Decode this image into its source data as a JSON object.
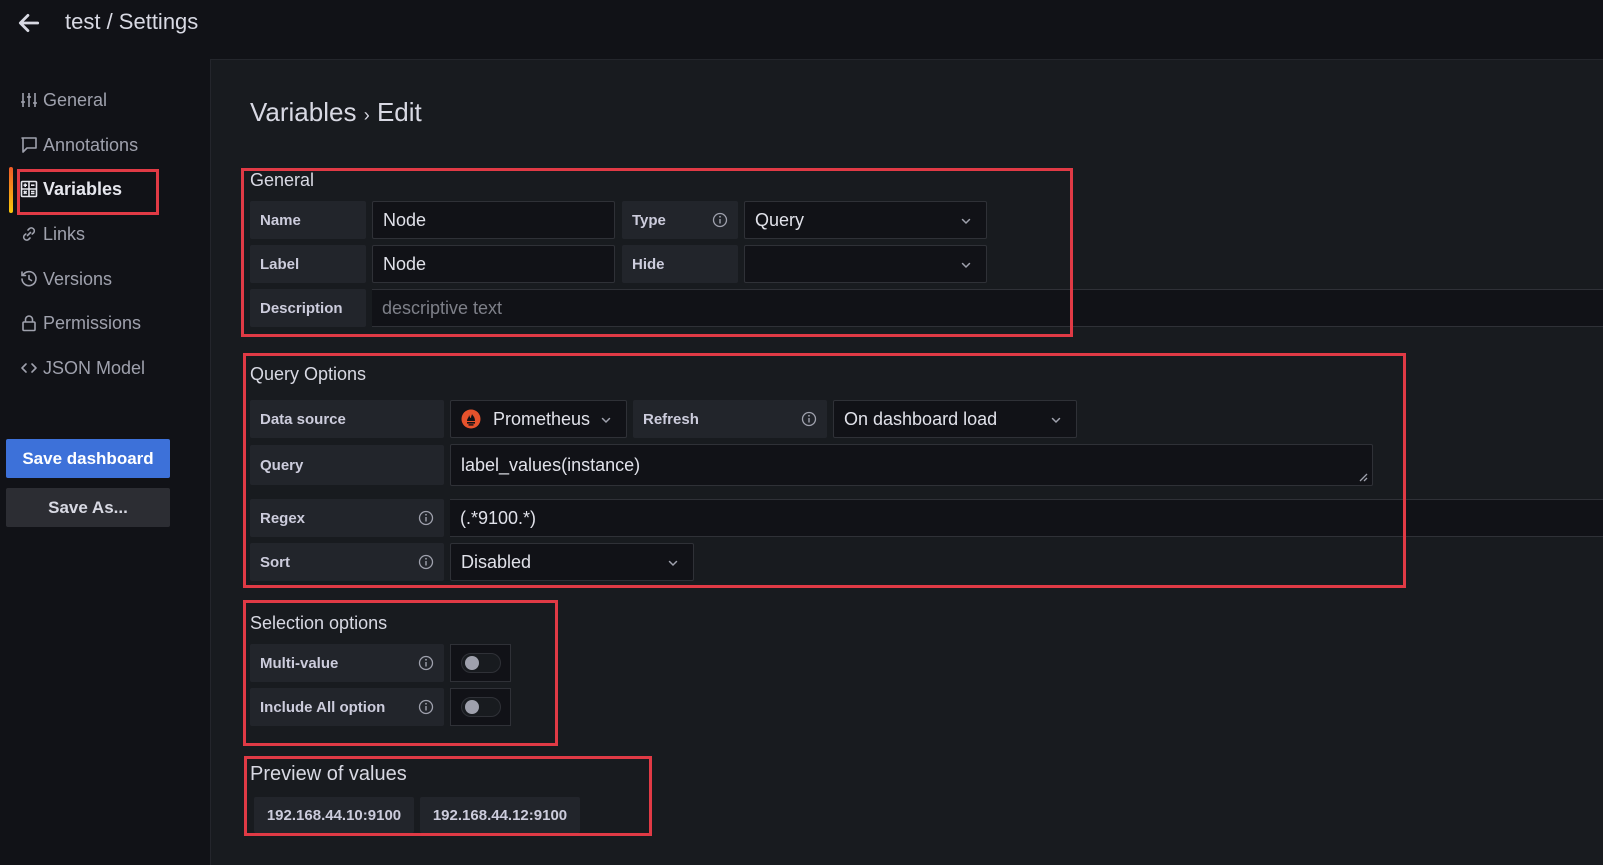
{
  "header": {
    "title": "test / Settings",
    "back_icon": "arrow-left-icon"
  },
  "sidebar": {
    "items": [
      {
        "label": "General",
        "icon": "sliders-icon",
        "active": false
      },
      {
        "label": "Annotations",
        "icon": "comment-icon",
        "active": false
      },
      {
        "label": "Variables",
        "icon": "calculator-icon",
        "active": true
      },
      {
        "label": "Links",
        "icon": "link-icon",
        "active": false
      },
      {
        "label": "Versions",
        "icon": "history-icon",
        "active": false
      },
      {
        "label": "Permissions",
        "icon": "lock-icon",
        "active": false
      },
      {
        "label": "JSON Model",
        "icon": "code-icon",
        "active": false
      }
    ],
    "save_label": "Save dashboard",
    "save_as_label": "Save As..."
  },
  "main": {
    "breadcrumb": {
      "parent": "Variables",
      "separator": "›",
      "current": "Edit"
    },
    "general": {
      "title": "General",
      "name_label": "Name",
      "name_value": "Node",
      "type_label": "Type",
      "type_value": "Query",
      "label_label": "Label",
      "label_value": "Node",
      "hide_label": "Hide",
      "hide_value": "",
      "description_label": "Description",
      "description_placeholder": "descriptive text"
    },
    "query_options": {
      "title": "Query Options",
      "datasource_label": "Data source",
      "datasource_value": "Prometheus",
      "datasource_icon": "prometheus-icon",
      "datasource_color": "#e6522c",
      "refresh_label": "Refresh",
      "refresh_value": "On dashboard load",
      "query_label": "Query",
      "query_value": "label_values(instance)",
      "regex_label": "Regex",
      "regex_value": "(.*9100.*)",
      "sort_label": "Sort",
      "sort_value": "Disabled"
    },
    "selection_options": {
      "title": "Selection options",
      "multi_value_label": "Multi-value",
      "multi_value_enabled": false,
      "include_all_label": "Include All option",
      "include_all_enabled": false
    },
    "preview": {
      "title": "Preview of values",
      "values": [
        "192.168.44.10:9100",
        "192.168.44.12:9100"
      ]
    }
  },
  "colors": {
    "accent_primary": "#3d71d9",
    "highlight_box": "#e03a45",
    "active_bar_start": "#f05a28",
    "active_bar_end": "#fbca0a"
  }
}
